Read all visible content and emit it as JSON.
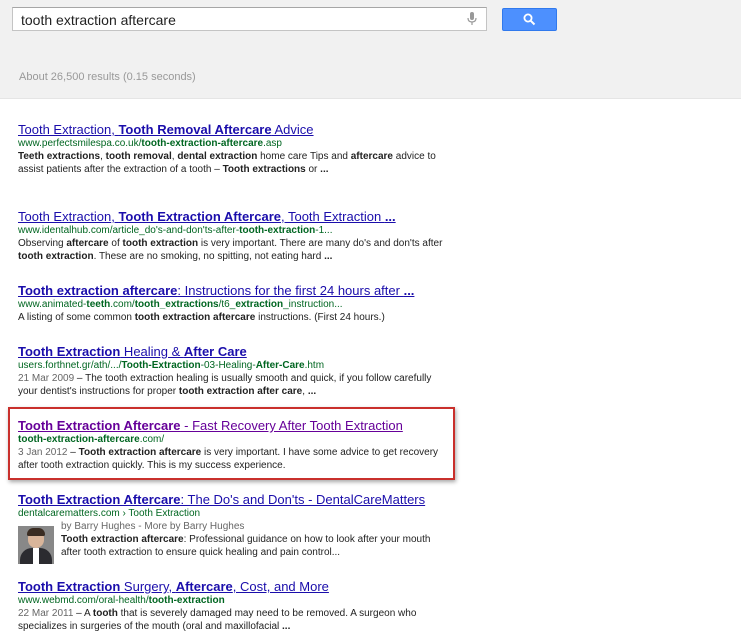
{
  "search": {
    "query": "tooth extraction aftercare"
  },
  "stats": "About 26,500 results (0.15 seconds)",
  "results": [
    {
      "title": [
        {
          "t": "Tooth Extraction",
          "b": false
        },
        {
          "t": ", ",
          "b": false
        },
        {
          "t": "Tooth Removal Aftercare",
          "b": true
        },
        {
          "t": " Advice",
          "b": false
        }
      ],
      "url": [
        {
          "t": "www.perfectsmilespa.co.uk/",
          "b": false
        },
        {
          "t": "tooth-extraction-aftercare",
          "b": true
        },
        {
          "t": ".asp",
          "b": false
        }
      ],
      "snippet": [
        {
          "t": "Teeth extractions",
          "b": true
        },
        {
          "t": ", ",
          "b": false
        },
        {
          "t": "tooth removal",
          "b": true
        },
        {
          "t": ", ",
          "b": false
        },
        {
          "t": "dental extraction",
          "b": true
        },
        {
          "t": " home care Tips and ",
          "b": false
        },
        {
          "t": "aftercare",
          "b": true
        },
        {
          "t": " advice to assist patients after the extraction of a tooth – ",
          "b": false
        },
        {
          "t": "Tooth extractions",
          "b": true
        },
        {
          "t": " or ",
          "b": false
        },
        {
          "t": "...",
          "b": true
        }
      ]
    },
    {
      "title": [
        {
          "t": "Tooth Extraction",
          "b": false
        },
        {
          "t": ", ",
          "b": false
        },
        {
          "t": "Tooth Extraction Aftercare",
          "b": true
        },
        {
          "t": ", Tooth Extraction ",
          "b": false
        },
        {
          "t": "...",
          "b": true
        }
      ],
      "url": [
        {
          "t": "www.identalhub.com/article_do's-and-don'ts-after-",
          "b": false
        },
        {
          "t": "tooth-extraction",
          "b": true
        },
        {
          "t": "-1...",
          "b": false
        }
      ],
      "snippet": [
        {
          "t": "Observing ",
          "b": false
        },
        {
          "t": "aftercare",
          "b": true
        },
        {
          "t": " of ",
          "b": false
        },
        {
          "t": "tooth extraction",
          "b": true
        },
        {
          "t": " is very important. There are many do's and don'ts after ",
          "b": false
        },
        {
          "t": "tooth extraction",
          "b": true
        },
        {
          "t": ". These are no smoking, no spitting, not eating hard ",
          "b": false
        },
        {
          "t": "...",
          "b": true
        }
      ]
    },
    {
      "title": [
        {
          "t": "Tooth extraction aftercare",
          "b": true
        },
        {
          "t": ": Instructions for the first 24 hours after ",
          "b": false
        },
        {
          "t": "...",
          "b": true
        }
      ],
      "url": [
        {
          "t": "www.animated-",
          "b": false
        },
        {
          "t": "teeth",
          "b": true
        },
        {
          "t": ".com/",
          "b": false
        },
        {
          "t": "tooth_extractions",
          "b": true
        },
        {
          "t": "/t6_",
          "b": false
        },
        {
          "t": "extraction",
          "b": true
        },
        {
          "t": "_instruction...",
          "b": false
        }
      ],
      "snippet": [
        {
          "t": "A listing of some common ",
          "b": false
        },
        {
          "t": "tooth extraction aftercare",
          "b": true
        },
        {
          "t": " instructions. (First 24 hours.)",
          "b": false
        }
      ]
    },
    {
      "title": [
        {
          "t": "Tooth Extraction",
          "b": true
        },
        {
          "t": " Healing & ",
          "b": false
        },
        {
          "t": "After Care",
          "b": true
        }
      ],
      "url": [
        {
          "t": "users.forthnet.gr/ath/.../",
          "b": false
        },
        {
          "t": "Tooth-Extraction",
          "b": true
        },
        {
          "t": "-03-Healing-",
          "b": false
        },
        {
          "t": "After-Care",
          "b": true
        },
        {
          "t": ".htm",
          "b": false
        }
      ],
      "date": "21 Mar 2009",
      "snippet": [
        {
          "t": " – The tooth extraction healing is usually smooth and quick, if you follow carefully your dentist's instructions for proper ",
          "b": false
        },
        {
          "t": "tooth extraction after care",
          "b": true
        },
        {
          "t": ", ",
          "b": false
        },
        {
          "t": "...",
          "b": true
        }
      ]
    },
    {
      "visited": true,
      "title": [
        {
          "t": "Tooth Extraction Aftercare",
          "b": true
        },
        {
          "t": " - Fast Recovery After Tooth Extraction",
          "b": false
        }
      ],
      "url": [
        {
          "t": "tooth-extraction-aftercare",
          "b": true
        },
        {
          "t": ".com/",
          "b": false
        }
      ],
      "date": "3 Jan 2012",
      "snippet": [
        {
          "t": " – ",
          "b": false
        },
        {
          "t": "Tooth extraction aftercare",
          "b": true
        },
        {
          "t": " is very important. I have some advice to get recovery after tooth extraction quickly. This is my success experience.",
          "b": false
        }
      ]
    },
    {
      "title": [
        {
          "t": "Tooth Extraction Aftercare",
          "b": true
        },
        {
          "t": ": The Do's and Don'ts - DentalCareMatters",
          "b": false
        }
      ],
      "url": [
        {
          "t": "dentalcarematters.com › Tooth Extraction",
          "b": false
        }
      ],
      "author": "by Barry Hughes - More by Barry Hughes",
      "snippet": [
        {
          "t": "Tooth extraction aftercare",
          "b": true
        },
        {
          "t": ": Professional guidance on how to look after your mouth after tooth extraction to ensure quick healing and pain control...",
          "b": false
        }
      ]
    },
    {
      "title": [
        {
          "t": "Tooth Extraction",
          "b": true
        },
        {
          "t": " Surgery, ",
          "b": false
        },
        {
          "t": "Aftercare",
          "b": true
        },
        {
          "t": ", Cost, and More",
          "b": false
        }
      ],
      "url": [
        {
          "t": "www.webmd.com/oral-health/",
          "b": false
        },
        {
          "t": "tooth-extraction",
          "b": true
        }
      ],
      "date": "22 Mar 2011",
      "snippet": [
        {
          "t": " – A ",
          "b": false
        },
        {
          "t": "tooth",
          "b": true
        },
        {
          "t": " that is severely damaged may need to be removed. A surgeon who specializes in surgeries of the mouth (oral and maxillofacial ",
          "b": false
        },
        {
          "t": "...",
          "b": true
        }
      ]
    }
  ],
  "colors": {
    "link": "#1a0dab",
    "visited": "#660099",
    "url": "#006621",
    "highlight": "#c9302c",
    "button": "#4d90fe"
  },
  "icons": [
    "search-icon",
    "microphone-icon"
  ]
}
